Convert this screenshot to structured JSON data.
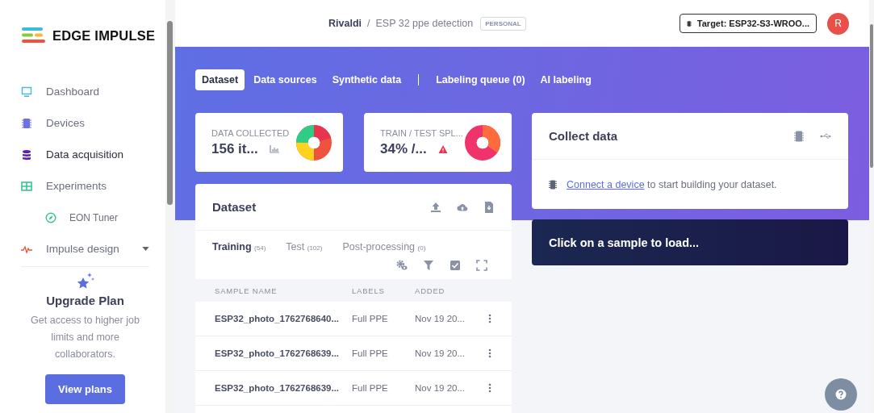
{
  "logo": {
    "text": "EDGE IMPULSE"
  },
  "sidebar": {
    "items": [
      {
        "label": "Dashboard",
        "selected": false
      },
      {
        "label": "Devices",
        "selected": false
      },
      {
        "label": "Data acquisition",
        "selected": true
      },
      {
        "label": "Experiments",
        "selected": false,
        "children": [
          {
            "label": "EON Tuner",
            "selected": false
          }
        ]
      },
      {
        "label": "Impulse design",
        "selected": false,
        "expanded": false
      }
    ]
  },
  "upgrade": {
    "title": "Upgrade Plan",
    "text": "Get access to higher job limits and more collaborators.",
    "button": "View plans"
  },
  "header": {
    "owner": "Rivaldi",
    "separator": "/",
    "project": "ESP 32 ppe detection",
    "badge": "PERSONAL",
    "target": "Target: ESP32-S3-WROO...",
    "avatar": "R"
  },
  "tabs": [
    {
      "label": "Dataset",
      "selected": true
    },
    {
      "label": "Data sources",
      "selected": false
    },
    {
      "label": "Synthetic data",
      "selected": false
    },
    {
      "label": "Labeling queue (0)",
      "selected": false
    },
    {
      "label": "AI labeling",
      "selected": false
    }
  ],
  "stats": [
    {
      "kind": "collected",
      "title": "DATA COLLECTED",
      "value": "156 it..."
    },
    {
      "kind": "split",
      "title": "TRAIN / TEST SPL...",
      "value": "34% /..."
    }
  ],
  "dataset": {
    "title": "Dataset",
    "subtabs": [
      {
        "label": "Training",
        "count": "(54)",
        "selected": true
      },
      {
        "label": "Test",
        "count": "(102)",
        "selected": false
      },
      {
        "label": "Post-processing",
        "count": "(0)",
        "selected": false
      }
    ],
    "columns": [
      "SAMPLE NAME",
      "LABELS",
      "ADDED"
    ],
    "rows": [
      {
        "name": "ESP32_photo_1762768640...",
        "label": "Full PPE",
        "added": "Nov 19 20..."
      },
      {
        "name": "ESP32_photo_1762768639...",
        "label": "Full PPE",
        "added": "Nov 19 20..."
      },
      {
        "name": "ESP32_photo_1762768639...",
        "label": "Full PPE",
        "added": "Nov 19 20..."
      }
    ]
  },
  "collect": {
    "title": "Collect data",
    "link": "Connect a device",
    "text": " to start building your dataset."
  },
  "sample_panel": {
    "text": "Click on a sample to load..."
  }
}
